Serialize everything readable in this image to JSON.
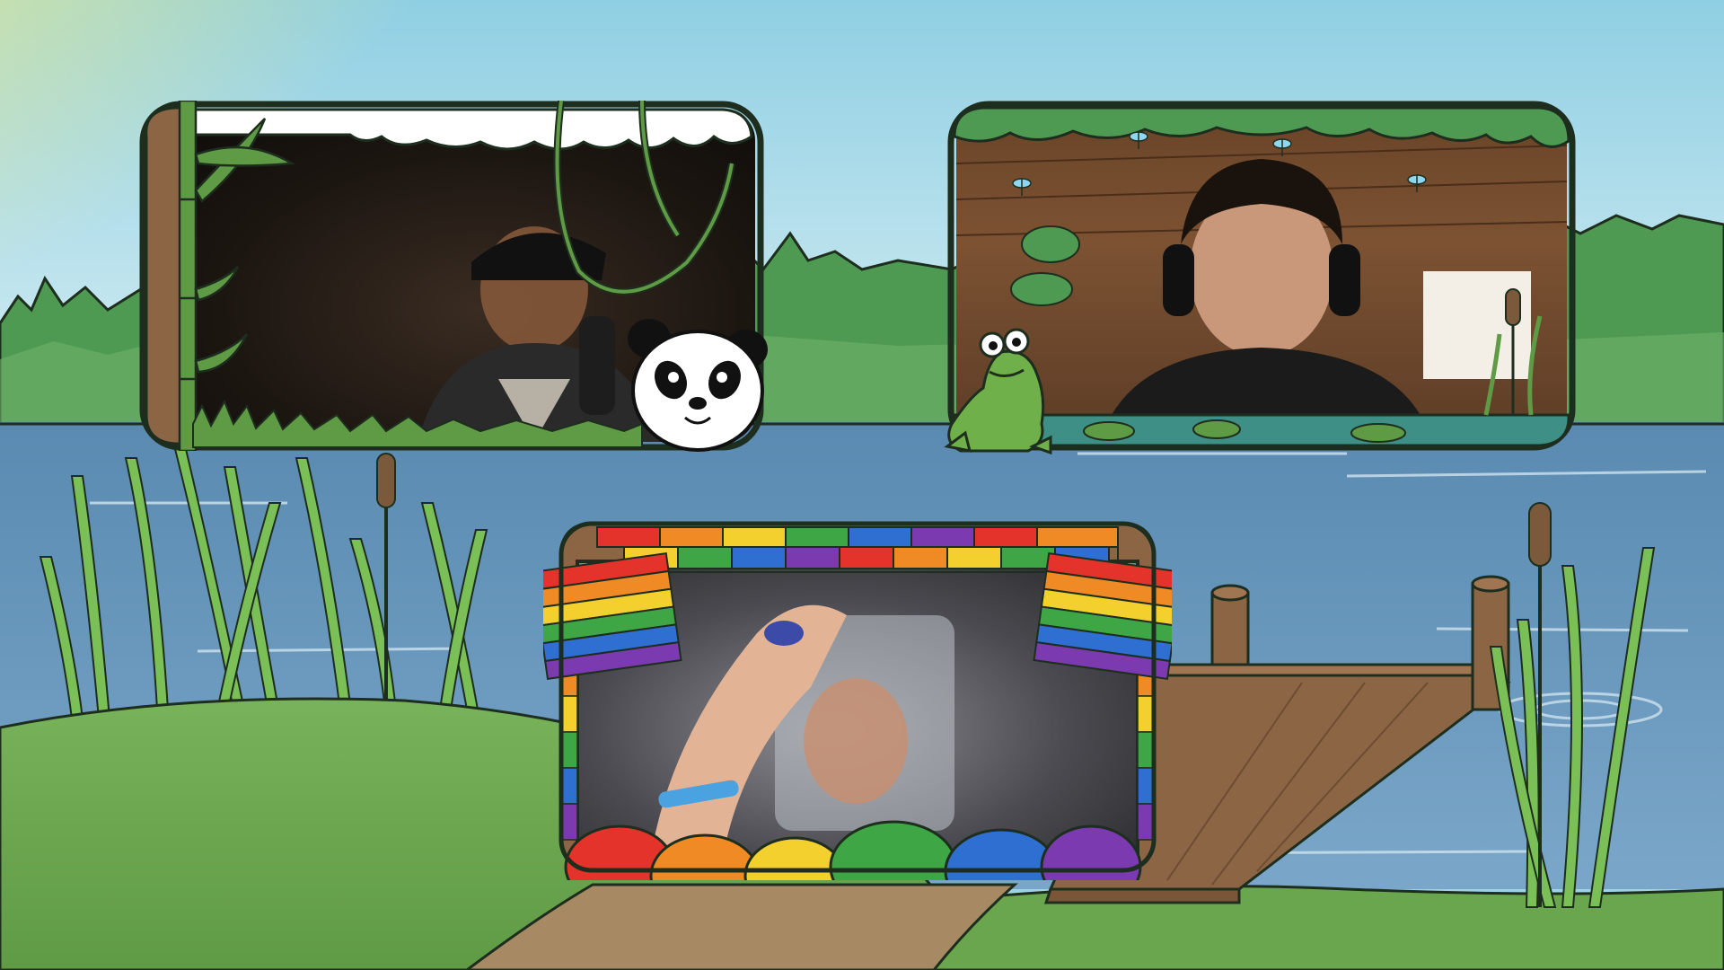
{
  "scene": {
    "name": "pond-stream-overlay",
    "colors": {
      "sky_top": "#8fcfe3",
      "sky_bottom": "#d7eef3",
      "sun": "#fff27a",
      "treeline": "#4f9a52",
      "water": "#5e8fb5",
      "grass": "#6fab50",
      "path": "#a78a63",
      "dock": "#8c6544",
      "outline": "#1e2e1e"
    }
  },
  "cameras": [
    {
      "id": "cam-top-left",
      "theme": "jungle-panda",
      "feed_tone": "#1c1611",
      "decorations": [
        "panda-icon",
        "bamboo-icon",
        "vine-icon",
        "cloud-icon"
      ]
    },
    {
      "id": "cam-top-right",
      "theme": "pond-frog",
      "feed_tone": "#5a3a22",
      "decorations": [
        "frog-icon",
        "dragonfly-icon",
        "lily-pad-icon",
        "cattail-icon"
      ]
    },
    {
      "id": "cam-bottom-center",
      "theme": "rainbow-curtain",
      "feed_tone": "#4a4a50",
      "decorations": [
        "rainbow-flag-icon",
        "rainbow-bunting-icon",
        "rainbow-balls-icon"
      ]
    }
  ],
  "rainbow": [
    "#e4332b",
    "#f08a24",
    "#f3d02e",
    "#3ea644",
    "#2f6fd1",
    "#7b3ab0"
  ]
}
